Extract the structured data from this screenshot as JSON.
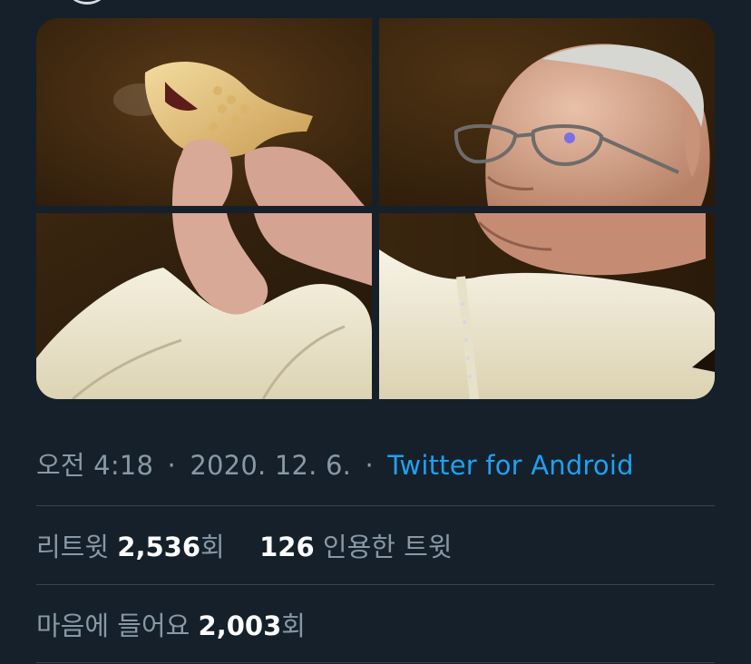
{
  "tweet": {
    "time": "오전 4:18",
    "date": "2020. 12. 6.",
    "separator": "·",
    "source": "Twitter for Android"
  },
  "media": {
    "tile_count": 4,
    "alt": [
      "fish-shaped pastry held up",
      "man in glasses looking down",
      "hands in white robe",
      "white vestment"
    ]
  },
  "stats": {
    "retweets_label": "리트윗",
    "retweets_count": "2,536",
    "retweets_suffix": "회",
    "quotes_count": "126",
    "quotes_label": "인용한 트윗",
    "likes_label": "마음에 들어요",
    "likes_count": "2,003",
    "likes_suffix": "회"
  },
  "colors": {
    "background": "#15202b",
    "muted_text": "#8899a6",
    "link": "#1da1f2",
    "divider": "#38444d"
  }
}
